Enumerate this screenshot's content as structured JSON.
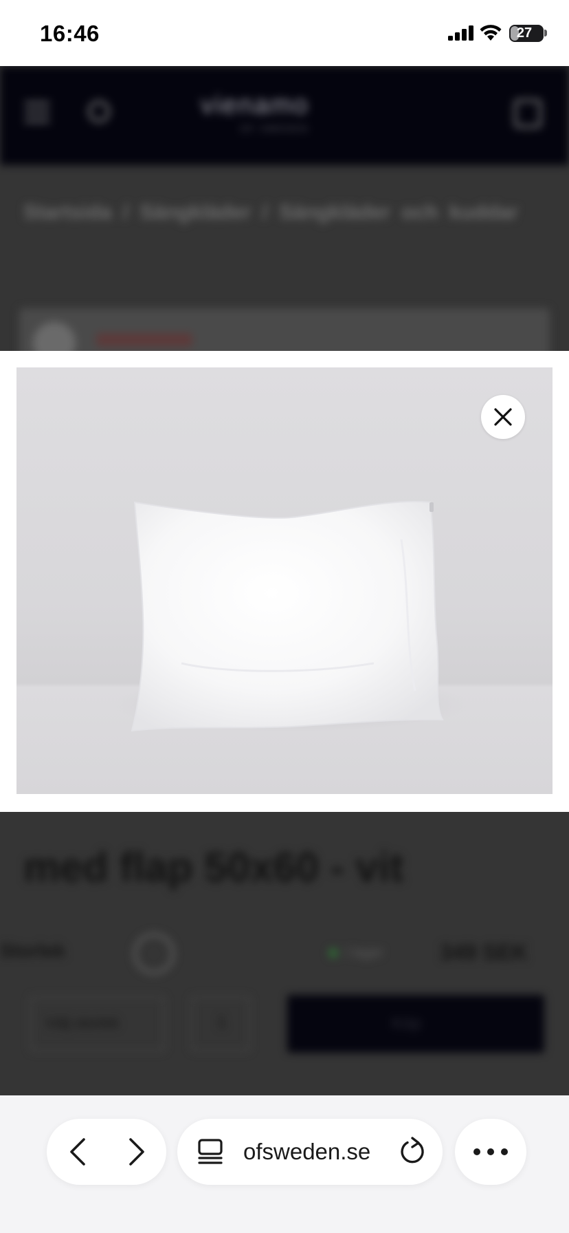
{
  "status_bar": {
    "time": "16:46",
    "battery_level": "27",
    "battery_fraction": 0.27
  },
  "site": {
    "logo": "vienamo",
    "logo_sub": "OF SWEDEN",
    "breadcrumb": "Startsida / Sängkläder / Sängkläder och kuddar",
    "title_line_2": "med flap 50x60 - vit",
    "size_label": "Storlek",
    "stock": "I lager",
    "price": "349 SEK",
    "variant_placeholder": "Välj storlek",
    "quantity": "1",
    "buy_label": "Köp"
  },
  "modal": {
    "image_alt": "White pillow 50x60 against light grey wall",
    "close_icon": "close-icon"
  },
  "toolbar": {
    "url": "ofsweden.se",
    "icons": {
      "back": "chevron-left-icon",
      "forward": "chevron-right-icon",
      "tabs": "tabs-icon",
      "reload": "reload-icon",
      "more": "more-icon"
    }
  },
  "colors": {
    "site_header": "#04040e",
    "overlay": "#353535",
    "toolbar_bg": "#f4f4f6"
  }
}
